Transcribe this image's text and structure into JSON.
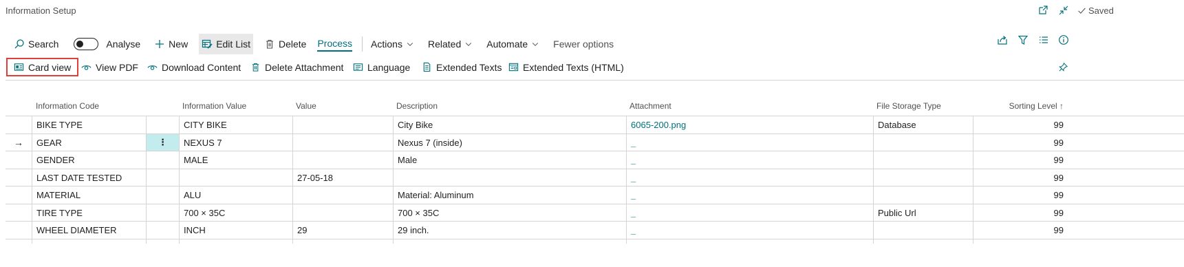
{
  "page": {
    "title": "Information Setup",
    "saved_label": "Saved"
  },
  "actionbar": {
    "search": "Search",
    "analyse": "Analyse",
    "new": "New",
    "edit_list": "Edit List",
    "delete": "Delete",
    "process": "Process",
    "actions": "Actions",
    "related": "Related",
    "automate": "Automate",
    "fewer_options": "Fewer options"
  },
  "promoted": {
    "card_view": "Card view",
    "view_pdf": "View PDF",
    "download_content": "Download Content",
    "delete_attachment": "Delete Attachment",
    "language": "Language",
    "extended_texts": "Extended Texts",
    "extended_texts_html": "Extended Texts (HTML)"
  },
  "table": {
    "headers": {
      "code": "Information Code",
      "info_value": "Information Value",
      "value": "Value",
      "description": "Description",
      "attachment": "Attachment",
      "storage": "File Storage Type",
      "sorting": "Sorting Level ↑"
    },
    "rows": [
      {
        "code": "BIKE TYPE",
        "info_value": "CITY BIKE",
        "value": "",
        "description": "City Bike",
        "attachment": "6065-200.png",
        "storage": "Database",
        "sorting": "99"
      },
      {
        "code": "GEAR",
        "info_value": "NEXUS 7",
        "value": "",
        "description": "Nexus 7 (inside)",
        "attachment": "_",
        "storage": "",
        "sorting": "99"
      },
      {
        "code": "GENDER",
        "info_value": "MALE",
        "value": "",
        "description": "Male",
        "attachment": "_",
        "storage": "",
        "sorting": "99"
      },
      {
        "code": "LAST DATE TESTED",
        "info_value": "",
        "value": "27-05-18",
        "description": "",
        "attachment": "_",
        "storage": "",
        "sorting": "99"
      },
      {
        "code": "MATERIAL",
        "info_value": "ALU",
        "value": "",
        "description": "Material: Aluminum",
        "attachment": "_",
        "storage": "",
        "sorting": "99"
      },
      {
        "code": "TIRE TYPE",
        "info_value": "700 × 35C",
        "value": "",
        "description": "700 × 35C",
        "attachment": "_",
        "storage": "Public Url",
        "sorting": "99"
      },
      {
        "code": "WHEEL DIAMETER",
        "info_value": "INCH",
        "value": "29",
        "description": "29 inch.",
        "attachment": "_",
        "storage": "",
        "sorting": "99"
      }
    ],
    "selected_row_marker": "→",
    "row_menu_glyph": "⋮"
  },
  "colors": {
    "accent": "#00717c",
    "highlight_border": "#e0403a",
    "selected_cell": "#c3ecef"
  }
}
